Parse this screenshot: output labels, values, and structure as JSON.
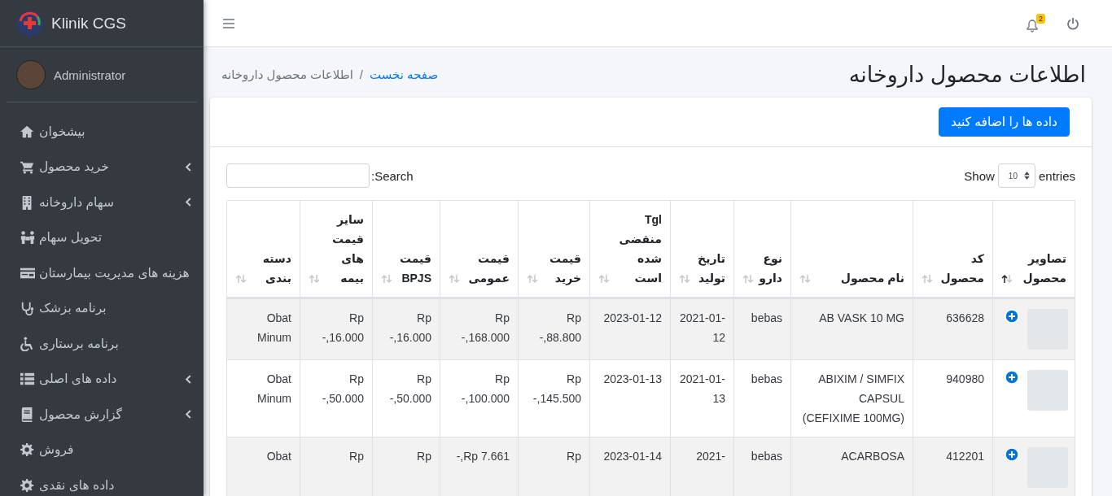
{
  "sidebar": {
    "brand": "Klinik CGS",
    "user": "Administrator",
    "items": [
      {
        "label": "بیشخوان",
        "has_submenu": false
      },
      {
        "label": "خرید محصول",
        "has_submenu": true
      },
      {
        "label": "سهام داروخانه",
        "has_submenu": true
      },
      {
        "label": "تحویل سهام",
        "has_submenu": false
      },
      {
        "label": "هزینه های مدیریت بیمارستان",
        "has_submenu": false
      },
      {
        "label": "برنامه بزشک",
        "has_submenu": false
      },
      {
        "label": "برنامه برستاری",
        "has_submenu": false
      },
      {
        "label": "داده های اصلی",
        "has_submenu": true
      },
      {
        "label": "گزارش محصول",
        "has_submenu": true
      },
      {
        "label": "فروش",
        "has_submenu": false
      },
      {
        "label": "داده های نقدی",
        "has_submenu": false
      }
    ]
  },
  "topbar": {
    "notification_count": "2"
  },
  "page": {
    "title": "اطلاعات محصول داروخانه",
    "breadcrumb": [
      {
        "label": "صفحه نخست",
        "link": true
      },
      {
        "label": "اطلاعات محصول داروخانه",
        "link": false
      }
    ],
    "breadcrumb_separator": "/"
  },
  "card": {
    "add_button": "داده ها را اضافه کنید",
    "show_label": "Show",
    "page_size": "10",
    "entries_label": "entries",
    "search_label": "Search:"
  },
  "table": {
    "columns": [
      {
        "label": "تصاویر محصول",
        "sorted": true
      },
      {
        "label": "کد محصول",
        "sorted": false
      },
      {
        "label": "نام محصول",
        "sorted": false
      },
      {
        "label": "نوع دارو",
        "sorted": false
      },
      {
        "label": "تاریخ تولید",
        "sorted": false
      },
      {
        "label": "Tgl منقضی شده است",
        "sorted": false
      },
      {
        "label": "قیمت خرید",
        "sorted": false
      },
      {
        "label": "قیمت عمومی",
        "sorted": false
      },
      {
        "label": "قیمت BPJS",
        "sorted": false
      },
      {
        "label": "سایر قیمت های بیمه",
        "sorted": false
      },
      {
        "label": "دسته بندی",
        "sorted": false
      }
    ],
    "rows": [
      {
        "cells": [
          "",
          "636628",
          "AB VASK 10 MG",
          "bebas",
          "2021-01-12",
          "2023-01-12",
          "Rp -,88.800",
          "Rp -,168.000",
          "Rp -,16.000",
          "Rp -,16.000",
          "Obat Minum"
        ]
      },
      {
        "cells": [
          "",
          "940980",
          "ABIXIM / SIMFIX CAPSUL (CEFIXIME 100MG)",
          "bebas",
          "2021-01-13",
          "2023-01-13",
          "Rp -,145.500",
          "Rp -,100.000",
          "Rp -,50.000",
          "Rp -,50.000",
          "Obat Minum"
        ]
      },
      {
        "cells": [
          "",
          "412201",
          "ACARBOSA",
          "bebas",
          "2021-",
          "2023-01-14",
          "Rp",
          "-,Rp 7.661",
          "Rp",
          "Rp",
          "Obat"
        ]
      }
    ]
  }
}
